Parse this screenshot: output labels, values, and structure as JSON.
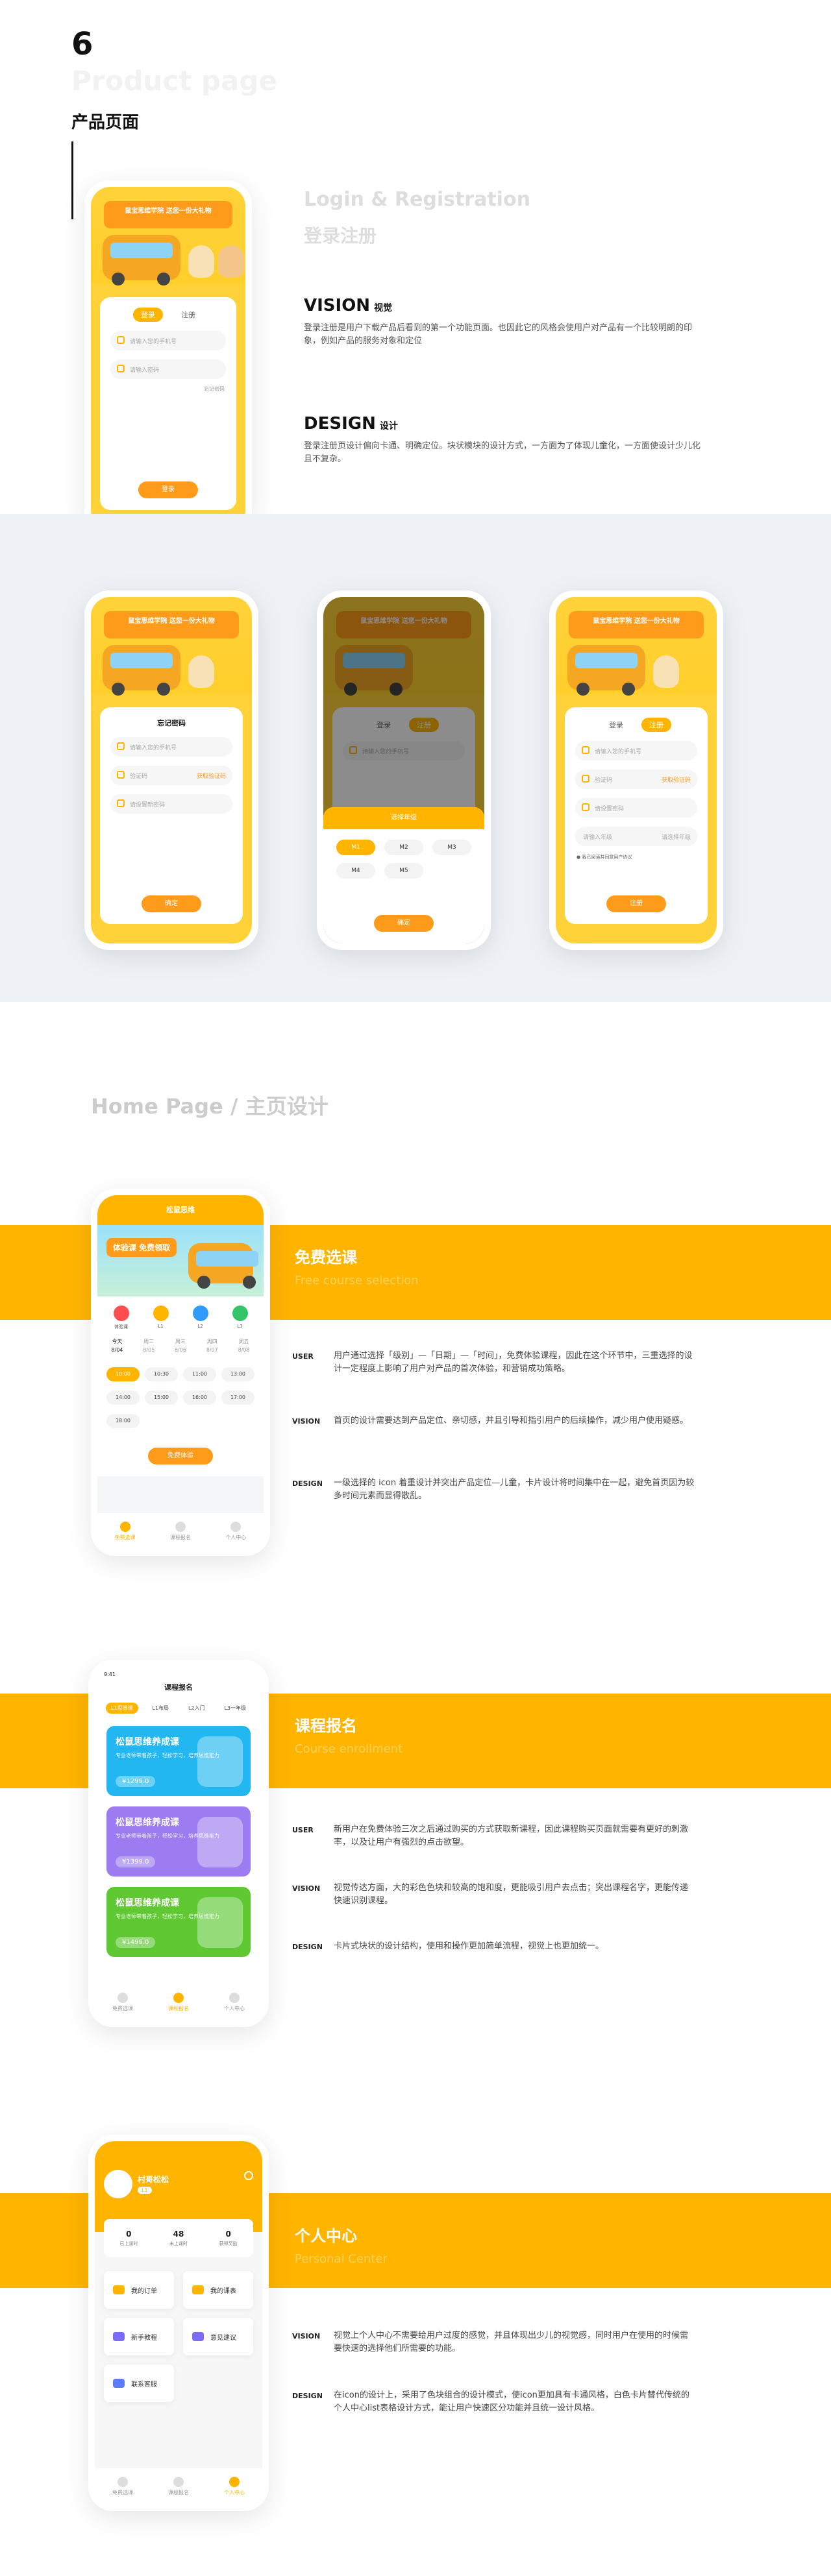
{
  "section": {
    "num": "6",
    "en": "Product page",
    "cn": "产品页面"
  },
  "login": {
    "title_en": "Login & Registration",
    "title_cn": "登录注册",
    "vision_title": "VISION",
    "vision_sub": "视觉",
    "vision_text": "登录注册是用户下载产品后看到的第一个功能页面。也因此它的风格会使用户对产品有一个比较明朗的印象，例如产品的服务对象和定位",
    "design_title": "DESIGN",
    "design_sub": "设计",
    "design_text": "登录注册页设计偏向卡通、明确定位。块状模块的设计方式，一方面为了体现儿童化，一方面使设计少儿化且不复杂。",
    "banner": "鼠宝思维学院\n送您一份大礼物",
    "tab_login": "登录",
    "tab_register": "注册",
    "phone_placeholder": "请输入您的手机号",
    "pwd_placeholder": "请输入密码",
    "forgot": "忘记密码",
    "btn_login": "登录",
    "forgot_title": "忘记密码",
    "code_placeholder": "验证码",
    "get_code": "获取验证码",
    "new_pwd_placeholder": "请设置新密码",
    "btn_confirm": "确定",
    "grade_title": "选择年级",
    "grades": [
      "M1",
      "M2",
      "M3",
      "M4",
      "M5"
    ],
    "btn_grade": "确定",
    "reg_pwd": "请设置密码",
    "reg_grade": "请输入年级",
    "reg_grade_sel": "请选择年级",
    "agree": "我已阅读并同意用户协议",
    "btn_register": "注册"
  },
  "home": {
    "title": "Home Page / 主页设计",
    "free": {
      "cn": "免费选课",
      "en": "Free course selection",
      "app_title": "松鼠思维",
      "banner": "体验课 免费领取",
      "cats": [
        "体验课",
        "L1",
        "L2",
        "L3"
      ],
      "days": [
        "今天",
        "周二",
        "周三",
        "周四",
        "周五"
      ],
      "dates": [
        "8/04",
        "8/05",
        "8/06",
        "8/07",
        "8/08"
      ],
      "times": [
        "10:00",
        "10:30",
        "11:00",
        "13:00",
        "14:00",
        "15:00",
        "16:00",
        "17:00",
        "18:00"
      ],
      "btn": "免费体验",
      "nav": [
        "免费选课",
        "课程报名",
        "个人中心"
      ],
      "user_text": "用户通过选择「级别」—「日期」—「时间」，免费体验课程，因此在这个环节中，三重选择的设计一定程度上影响了用户对产品的首次体验，和营销成功策略。",
      "vision_text": "首页的设计需要达到产品定位、亲切感，并且引导和指引用户的后续操作，减少用户使用疑惑。",
      "design_text": "一级选择的 icon 着重设计并突出产品定位—儿童，卡片设计将时间集中在一起，避免首页因为较多时间元素而显得散乱。"
    },
    "course": {
      "cn": "课程报名",
      "en": "Course enrollment",
      "status": "9:41",
      "app_title": "课程报名",
      "tabs": [
        "L1思维课",
        "L1布局",
        "L2入门",
        "L3一年级"
      ],
      "cards": [
        {
          "title": "松鼠思维养成课",
          "desc": "专业老师带着孩子，轻松学习，培养思维能力",
          "price": "¥1299.0"
        },
        {
          "title": "松鼠思维养成课",
          "desc": "专业老师带着孩子，轻松学习，培养思维能力",
          "price": "¥1399.0"
        },
        {
          "title": "松鼠思维养成课",
          "desc": "专业老师带着孩子，轻松学习，培养思维能力",
          "price": "¥1499.0"
        }
      ],
      "user_text": "新用户在免费体验三次之后通过购买的方式获取新课程，因此课程购买页面就需要有更好的刺激率，以及让用户有强烈的点击欲望。",
      "vision_text": "视觉传达方面，大的彩色色块和较高的饱和度，更能吸引用户去点击；突出课程名字，更能传递快速识别课程。",
      "design_text": "卡片式块状的设计结构，使用和操作更加简单流程，视觉上也更加统一。"
    },
    "center": {
      "cn": "个人中心",
      "en": "Personal Center",
      "name": "村哥松松",
      "level": "L1",
      "stats": [
        {
          "v": "0",
          "l": "已上课时"
        },
        {
          "v": "48",
          "l": "未上课时"
        },
        {
          "v": "0",
          "l": "获得奖励"
        }
      ],
      "menu": [
        "我的订单",
        "我的课表",
        "新手教程",
        "意见建议",
        "联系客服"
      ],
      "vision_text": "视觉上个人中心不需要给用户过度的感觉，并且体现出少儿的视觉感，同时用户在使用的时候需要快速的选择他们所需要的功能。",
      "design_text": "在icon的设计上，采用了色块组合的设计模式，使icon更加具有卡通风格，白色卡片替代传统的个人中心list表格设计方式，能让用户快速区分功能并且统一设计风格。"
    }
  },
  "labels": {
    "user": "USER",
    "vision": "VISION",
    "design": "DESIGN"
  },
  "colors": {
    "accent": "#ffb400",
    "orange": "#ff9b1a",
    "band": "#eef1f6"
  }
}
